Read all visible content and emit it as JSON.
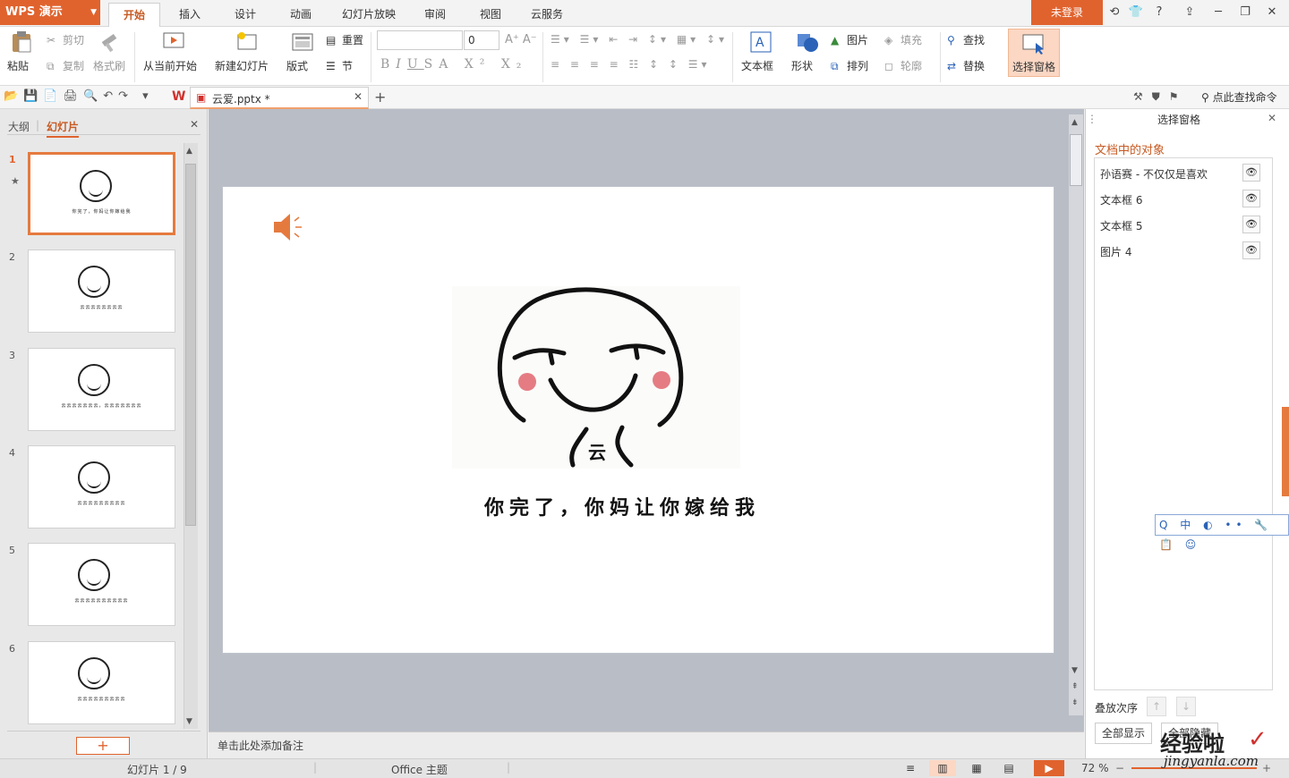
{
  "app": {
    "name": "WPS 演示",
    "login": "未登录"
  },
  "tabs": [
    "开始",
    "插入",
    "设计",
    "动画",
    "幻灯片放映",
    "审阅",
    "视图",
    "云服务"
  ],
  "ribbon": {
    "paste": "粘贴",
    "cut": "剪切",
    "copy": "复制",
    "format_painter": "格式刷",
    "from_current": "从当前开始",
    "new_slide": "新建幻灯片",
    "layout": "版式",
    "reset": "重置",
    "section": "节",
    "font_size": "0",
    "textbox": "文本框",
    "shape": "形状",
    "picture": "图片",
    "fill": "填充",
    "arrange": "排列",
    "outline": "轮廓",
    "find": "查找",
    "replace": "替换",
    "selection_pane": "选择窗格"
  },
  "qat": {
    "doc_tab": "云爱.pptx *",
    "search_cmd": "点此查找命令"
  },
  "left_panel": {
    "tab_outline": "大纲",
    "tab_slides": "幻灯片",
    "slides": [
      {
        "num": "1",
        "caption": "你完了，你妈让你嫁给我"
      },
      {
        "num": "2",
        "caption": "云云云云云云云云"
      },
      {
        "num": "3",
        "caption": "云云云云云云云，云云云云云云云"
      },
      {
        "num": "4",
        "caption": "云云云云云云云云云"
      },
      {
        "num": "5",
        "caption": "云云云云云云云云云云"
      },
      {
        "num": "6",
        "caption": "云云云云云云云云云"
      }
    ]
  },
  "slide": {
    "face_text": "云",
    "caption": "你完了，你妈让你嫁给我"
  },
  "notes": {
    "placeholder": "单击此处添加备注"
  },
  "selection_pane": {
    "title": "选择窗格",
    "section": "文档中的对象",
    "objects": [
      "孙语赛 - 不仅仅是喜欢",
      "文本框 6",
      "文本框 5",
      "图片 4"
    ],
    "order_label": "叠放次序",
    "show_all": "全部显示",
    "hide_all": "全部隐藏"
  },
  "status": {
    "slide_index": "幻灯片 1 / 9",
    "theme": "Office 主题",
    "zoom": "72 %"
  },
  "watermark": {
    "line1": "经验啦",
    "line2": "jingyanla.com"
  },
  "ime": {
    "text": "Q 中 ◐ •• 🔧 📋 ☺"
  },
  "colors": {
    "accent": "#e0632e",
    "slide_bg": "#ffffff",
    "canvas_bg": "#b9bdc6"
  }
}
